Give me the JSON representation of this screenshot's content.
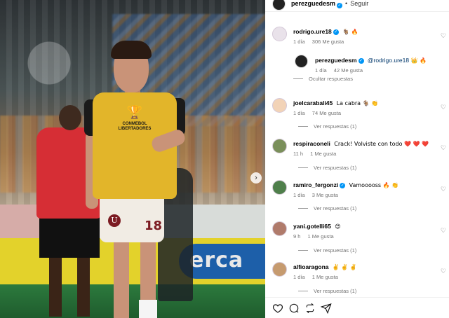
{
  "photo": {
    "badge_line1": "CONMEBOL",
    "badge_line2": "LIBERTADORES",
    "shorts_number": "18",
    "crest_letter": "U",
    "ad_text": "erca",
    "next_arrow": "›"
  },
  "post": {
    "author": "perezguedesm",
    "separator": "•",
    "follow_label": "Seguir"
  },
  "comments": [
    {
      "user": "rodrigo.ure18",
      "verified": true,
      "text": "🐐 🔥",
      "time": "1 día",
      "likes": "306 Me gusta",
      "action": "Ocultar respuestas",
      "avatar_color": "#e9e2ea",
      "reply": {
        "user": "perezguedesm",
        "verified": true,
        "mention": "@rodrigo.ure18",
        "text": "👑 🔥",
        "time": "1 día",
        "likes": "42 Me gusta"
      }
    },
    {
      "user": "joelcarabali45",
      "verified": false,
      "text": "La cabra 🐐 👏",
      "time": "1 día",
      "likes": "74 Me gusta",
      "action": "Ver respuestas (1)",
      "avatar_color": "#f2d3b7"
    },
    {
      "user": "respiraconeli",
      "verified": false,
      "text": "Crack! Volviste con todo ❤️ ❤️ ❤️",
      "time": "11 h",
      "likes": "1 Me gusta",
      "action": "Ver respuestas (1)",
      "avatar_color": "#7a8f5a"
    },
    {
      "user": "ramiro_fergonzi",
      "verified": true,
      "text": "Vamooooss 🔥 👏",
      "time": "1 día",
      "likes": "3 Me gusta",
      "action": "Ver respuestas (1)",
      "avatar_color": "#4f7f4b"
    },
    {
      "user": "yani.gotelli65",
      "verified": false,
      "text": "😍",
      "time": "9 h",
      "likes": "1 Me gusta",
      "action": "Ver respuestas (1)",
      "avatar_color": "#b07b6b"
    },
    {
      "user": "alfioaragona",
      "verified": false,
      "text": "✌️ ✌️ ✌️",
      "time": "1 día",
      "likes": "1 Me gusta",
      "action": "Ver respuestas (1)",
      "avatar_color": "#c69b6f"
    }
  ],
  "actions": [
    "heart-icon",
    "comment-icon",
    "repost-icon",
    "share-icon"
  ]
}
